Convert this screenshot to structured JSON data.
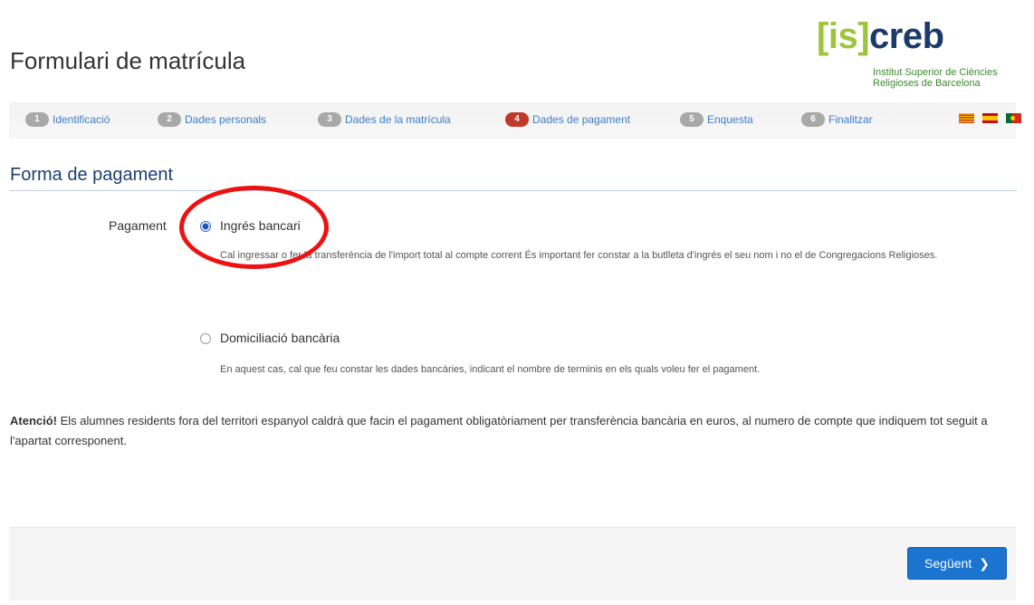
{
  "header": {
    "title": "Formulari de matrícula",
    "logo": {
      "open_bracket": "[",
      "is": "is",
      "close_bracket": "]",
      "creb": "creb",
      "line1": "Institut Superior de Ciències",
      "line2": "Religioses de Barcelona"
    }
  },
  "steps": [
    {
      "num": "1",
      "label": "Identificació",
      "active": false
    },
    {
      "num": "2",
      "label": "Dades personals",
      "active": false
    },
    {
      "num": "3",
      "label": "Dades de la matrícula",
      "active": false
    },
    {
      "num": "4",
      "label": "Dades de pagament",
      "active": true
    },
    {
      "num": "5",
      "label": "Enquesta",
      "active": false
    },
    {
      "num": "6",
      "label": "Finalitzar",
      "active": false
    }
  ],
  "languages": [
    "catalan-flag-icon",
    "spanish-flag-icon",
    "portuguese-flag-icon"
  ],
  "section": {
    "title": "Forma de pagament"
  },
  "payment": {
    "label": "Pagament",
    "options": [
      {
        "label": "Ingrés bancari",
        "checked": true,
        "help": "Cal ingressar o fer la transferència de l'import total al compte corrent És important fer constar a la butlleta d'ingrés el seu nom i no el de Congregacions Religioses."
      },
      {
        "label": "Domiciliació bancària",
        "checked": false,
        "help": "En aquest cas, cal que feu constar les dades bancàries, indicant el nombre de terminis en els quals voleu fer el pagament."
      }
    ]
  },
  "notice": {
    "bold": "Atenció!",
    "text": " Els alumnes residents fora del territori espanyol caldrà que facin el pagament obligatòriament per transferència bancària en euros, al numero de compte que indiquem tot seguit a l'apartat corresponent."
  },
  "footer": {
    "next_label": "Següent",
    "next_icon": "chevron-right-icon"
  },
  "colors": {
    "accent": "#1b74cf",
    "active_step": "#c0392b",
    "annotation": "#ee1111"
  }
}
